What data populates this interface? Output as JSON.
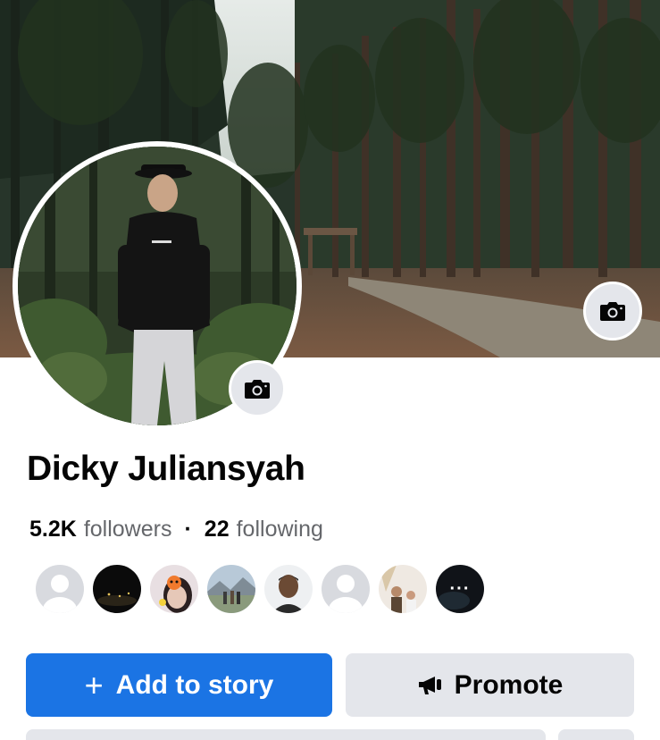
{
  "profile": {
    "name": "Dicky Juliansyah",
    "followers_count": "5.2K",
    "followers_label": "followers",
    "separator": "·",
    "following_count": "22",
    "following_label": "following"
  },
  "friends": [
    {
      "type": "default-avatar"
    },
    {
      "type": "dark-photo"
    },
    {
      "type": "sticker-photo"
    },
    {
      "type": "outdoor-group-photo"
    },
    {
      "type": "portrait-photo"
    },
    {
      "type": "default-avatar"
    },
    {
      "type": "group-photo"
    },
    {
      "type": "more",
      "label": "···"
    }
  ],
  "actions": {
    "add_story_icon": "+",
    "add_story_label": "Add to story",
    "promote_label": "Promote",
    "promote_icon": "megaphone-icon"
  },
  "icons": {
    "cover_camera": "camera-icon",
    "avatar_camera": "camera-icon"
  },
  "colors": {
    "primary": "#1b74e4",
    "secondary_button": "#e4e6eb",
    "text": "#050505",
    "muted_text": "#65676b"
  }
}
